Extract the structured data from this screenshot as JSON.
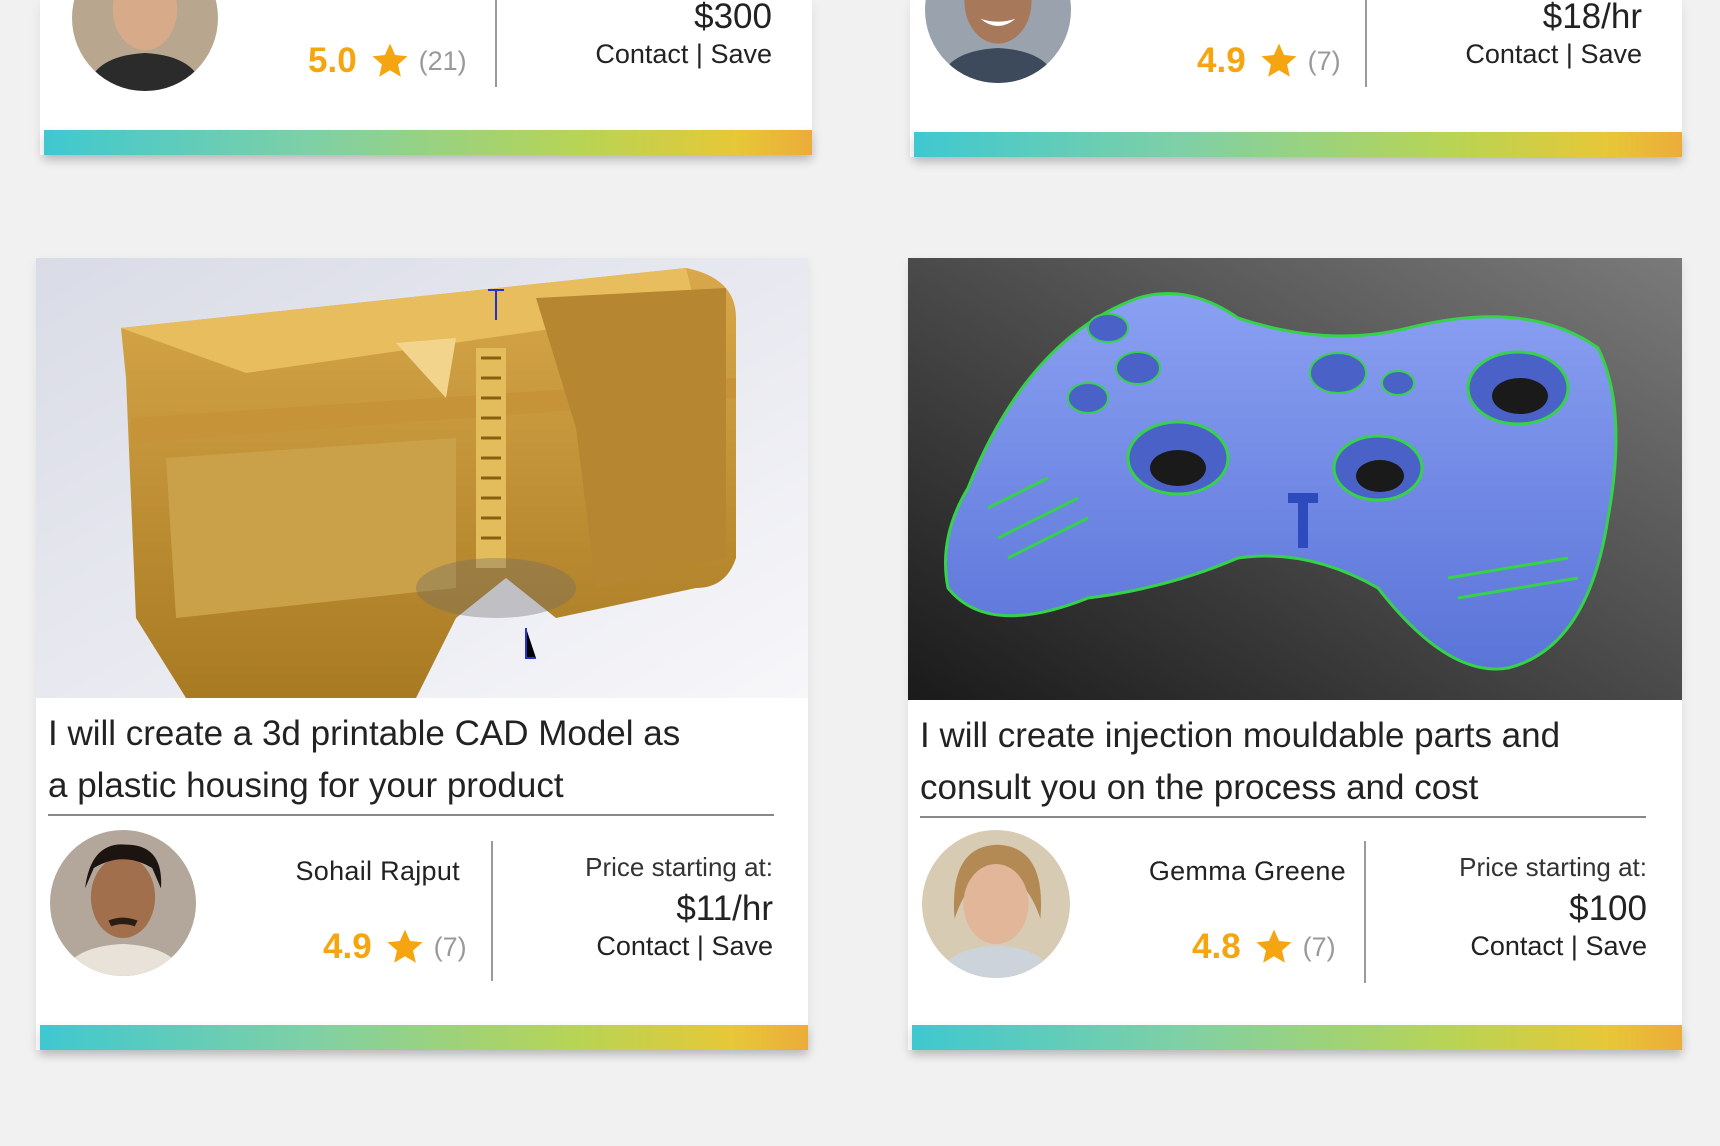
{
  "cards_top": [
    {
      "score": "5.0",
      "count": "(21)",
      "price": "$300",
      "contact": "Contact",
      "separator": " | ",
      "save": "Save"
    },
    {
      "score": "4.9",
      "count": "(7)",
      "price": "$18/hr",
      "contact": "Contact",
      "separator": " | ",
      "save": "Save"
    }
  ],
  "cards_bottom": [
    {
      "title_line1": "I will create a 3d printable CAD Model as",
      "title_line2": "a plastic housing for your product",
      "seller": "Sohail Rajput",
      "score": "4.9",
      "count": "(7)",
      "price_label": "Price starting at:",
      "price": "$11/hr",
      "contact": "Contact",
      "separator": " | ",
      "save": "Save"
    },
    {
      "title_line1": "I will create injection mouldable parts and",
      "title_line2": "consult you on the process and cost",
      "seller": "Gemma Greene",
      "score": "4.8",
      "count": "(7)",
      "price_label": "Price starting at:",
      "price": "$100",
      "contact": "Contact",
      "separator": " | ",
      "save": "Save"
    }
  ],
  "icons": [
    "star-icon"
  ],
  "colors": {
    "rating": "#f5a510",
    "gradient_start": "#3fc8d0",
    "gradient_end": "#ecac3a"
  }
}
